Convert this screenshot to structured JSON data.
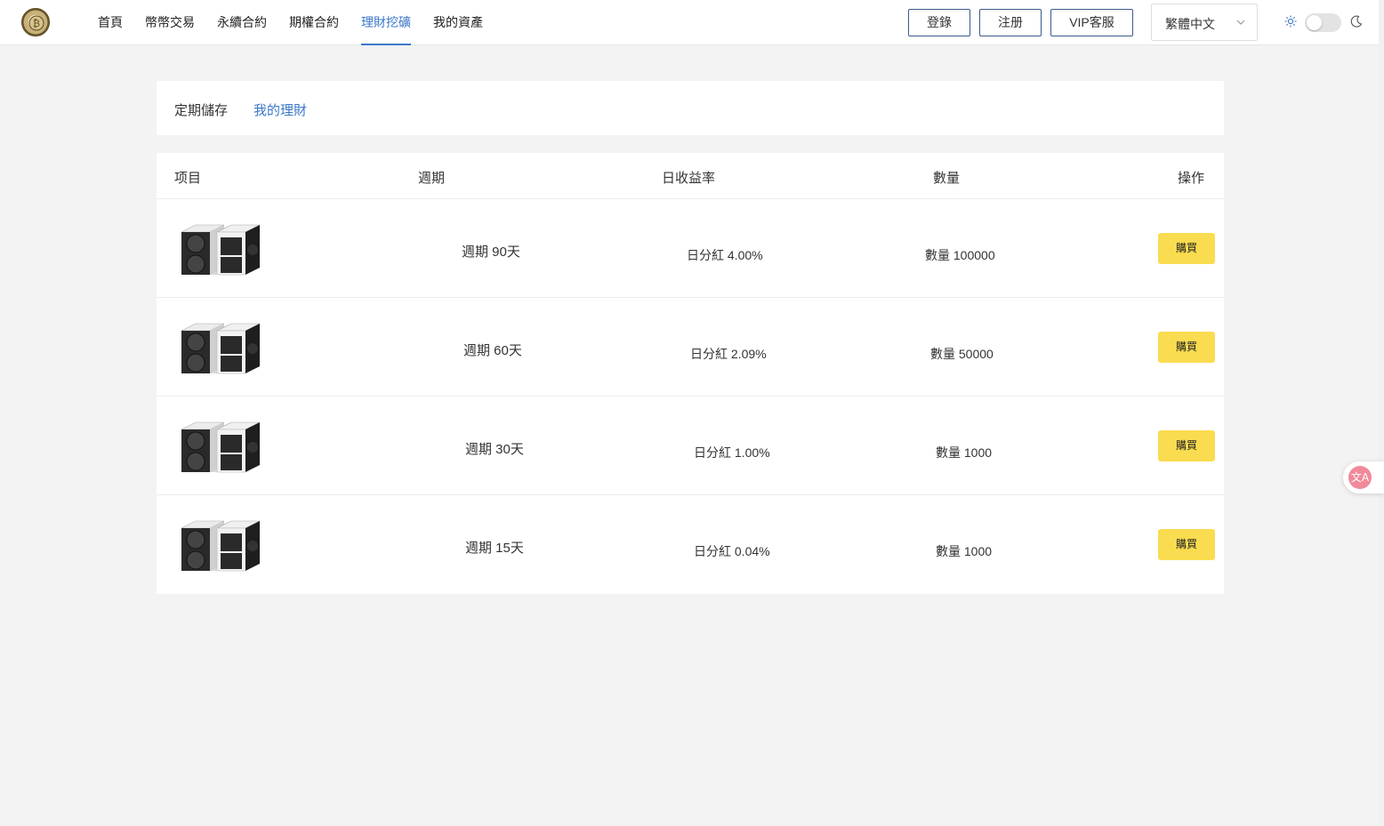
{
  "header": {
    "nav": [
      {
        "label": "首頁",
        "active": false
      },
      {
        "label": "幣幣交易",
        "active": false
      },
      {
        "label": "永續合約",
        "active": false
      },
      {
        "label": "期權合約",
        "active": false
      },
      {
        "label": "理財挖礦",
        "active": true
      },
      {
        "label": "我的資產",
        "active": false
      }
    ],
    "login_label": "登錄",
    "register_label": "注册",
    "vip_label": "VIP客服",
    "language": "繁體中文",
    "theme_icons": {
      "light": "sun-icon",
      "dark": "moon-icon"
    },
    "accent_color": "#3c78c8"
  },
  "tabs": [
    {
      "label": "定期儲存",
      "active": false
    },
    {
      "label": "我的理財",
      "active": true
    }
  ],
  "table": {
    "headers": {
      "item": "项目",
      "period": "週期",
      "rate": "日收益率",
      "quantity": "數量",
      "action": "操作"
    },
    "rows": [
      {
        "image": "mining-machine",
        "period": "週期 90天",
        "rate": "日分紅 4.00%",
        "quantity": "數量 100000",
        "buy_label": "購買"
      },
      {
        "image": "mining-machine",
        "period": "週期 60天",
        "rate": "日分紅 2.09%",
        "quantity": "數量 50000",
        "buy_label": "購買"
      },
      {
        "image": "mining-machine",
        "period": "週期 30天",
        "rate": "日分紅 1.00%",
        "quantity": "數量 1000",
        "buy_label": "購買"
      },
      {
        "image": "mining-machine",
        "period": "週期 15天",
        "rate": "日分紅 0.04%",
        "quantity": "數量 1000",
        "buy_label": "購買"
      }
    ],
    "buy_button_color": "#fadc50"
  },
  "floating_widget": {
    "icon": "translate-icon",
    "glyph": "文A"
  }
}
